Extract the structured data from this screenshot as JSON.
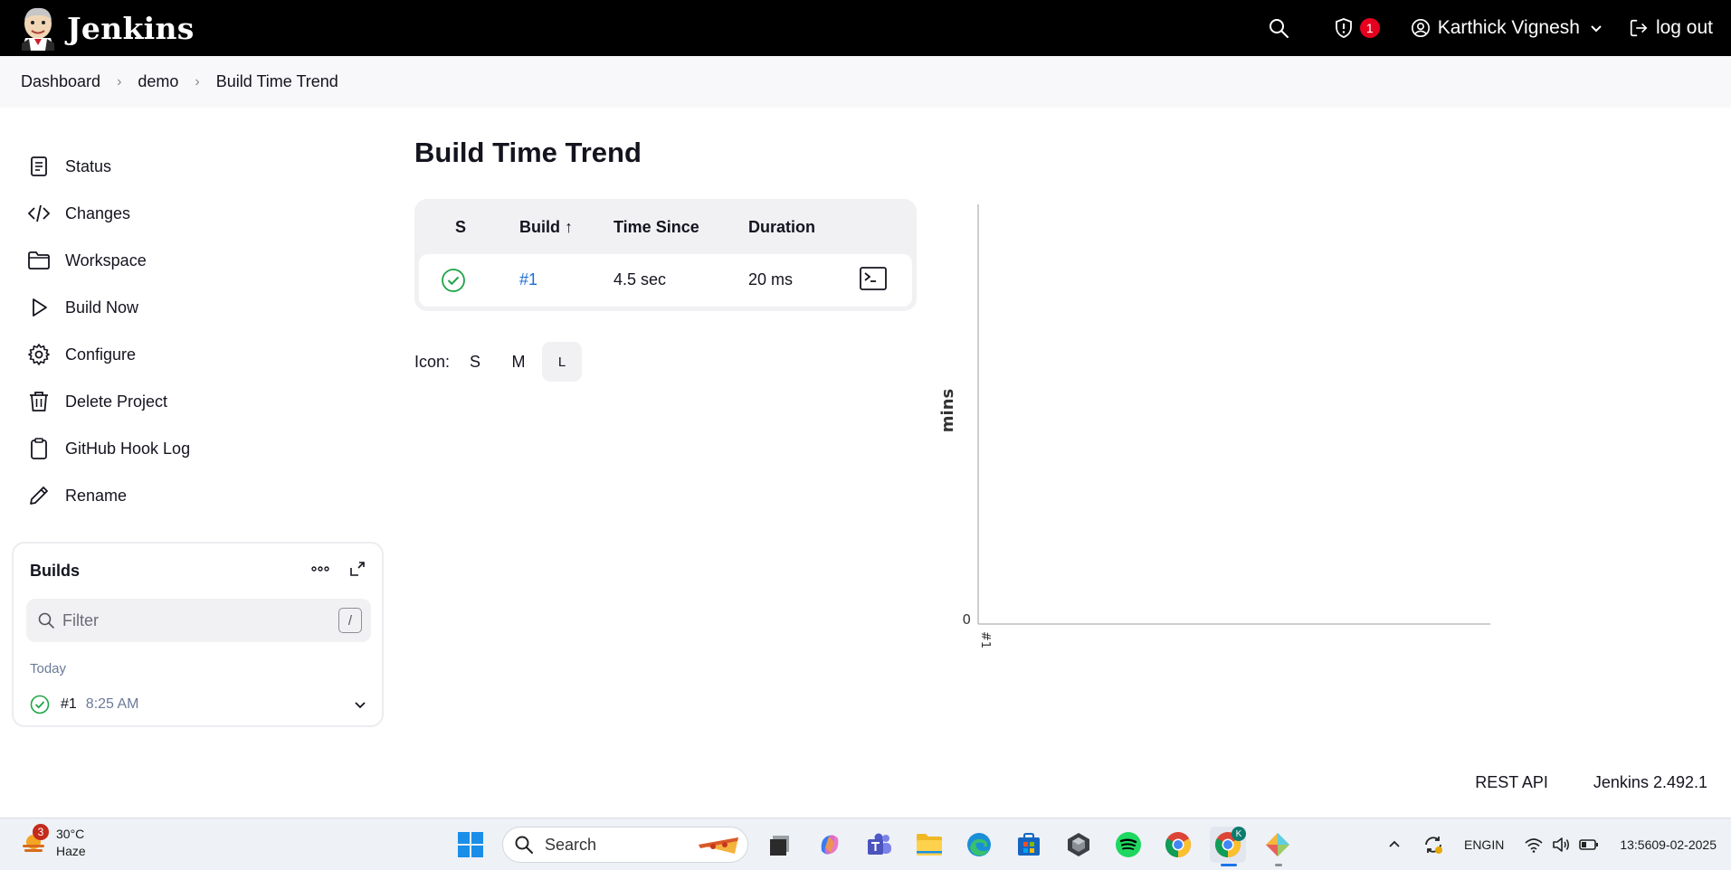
{
  "header": {
    "brand": "Jenkins",
    "alert_count": "1",
    "user_name": "Karthick Vignesh",
    "logout_label": "log out"
  },
  "breadcrumb": [
    "Dashboard",
    "demo",
    "Build Time Trend"
  ],
  "sidebar": {
    "items": [
      {
        "label": "Status",
        "icon": "notepad-icon"
      },
      {
        "label": "Changes",
        "icon": "code-icon"
      },
      {
        "label": "Workspace",
        "icon": "folder-icon"
      },
      {
        "label": "Build Now",
        "icon": "play-icon"
      },
      {
        "label": "Configure",
        "icon": "gear-icon"
      },
      {
        "label": "Delete Project",
        "icon": "trash-icon"
      },
      {
        "label": "GitHub Hook Log",
        "icon": "clipboard-icon"
      },
      {
        "label": "Rename",
        "icon": "pencil-icon"
      }
    ]
  },
  "builds_panel": {
    "title": "Builds",
    "filter_placeholder": "Filter",
    "shortcut_key": "/",
    "group_label": "Today",
    "builds": [
      {
        "number": "#1",
        "time": "8:25 AM",
        "status": "success"
      }
    ]
  },
  "main": {
    "title": "Build Time Trend",
    "table": {
      "headers": [
        "S",
        "Build ↑",
        "Time Since",
        "Duration"
      ],
      "rows": [
        {
          "status": "success",
          "build": "#1",
          "time_since": "4.5 sec",
          "duration": "20 ms"
        }
      ]
    },
    "icon_size": {
      "label": "Icon:",
      "options": [
        "S",
        "M",
        "L"
      ],
      "selected": "L"
    }
  },
  "chart_data": {
    "type": "area",
    "x": [
      "#1"
    ],
    "series": [
      {
        "values": [
          0.0003
        ]
      }
    ],
    "xlabel": "",
    "ylabel": "mins",
    "y_tick_labels": [
      "0"
    ],
    "grid": false
  },
  "footer": {
    "rest_api": "REST API",
    "version": "Jenkins 2.492.1"
  },
  "taskbar": {
    "weather_badge": "3",
    "temperature": "30°C",
    "condition": "Haze",
    "search_label": "Search",
    "language_top": "ENG",
    "language_bottom": "IN",
    "time": "13:56",
    "date": "09-02-2025",
    "chrome_profile_letter": "K"
  },
  "colors": {
    "success": "#1ea446",
    "link": "#1c6ed5",
    "alert": "#e6001f"
  }
}
